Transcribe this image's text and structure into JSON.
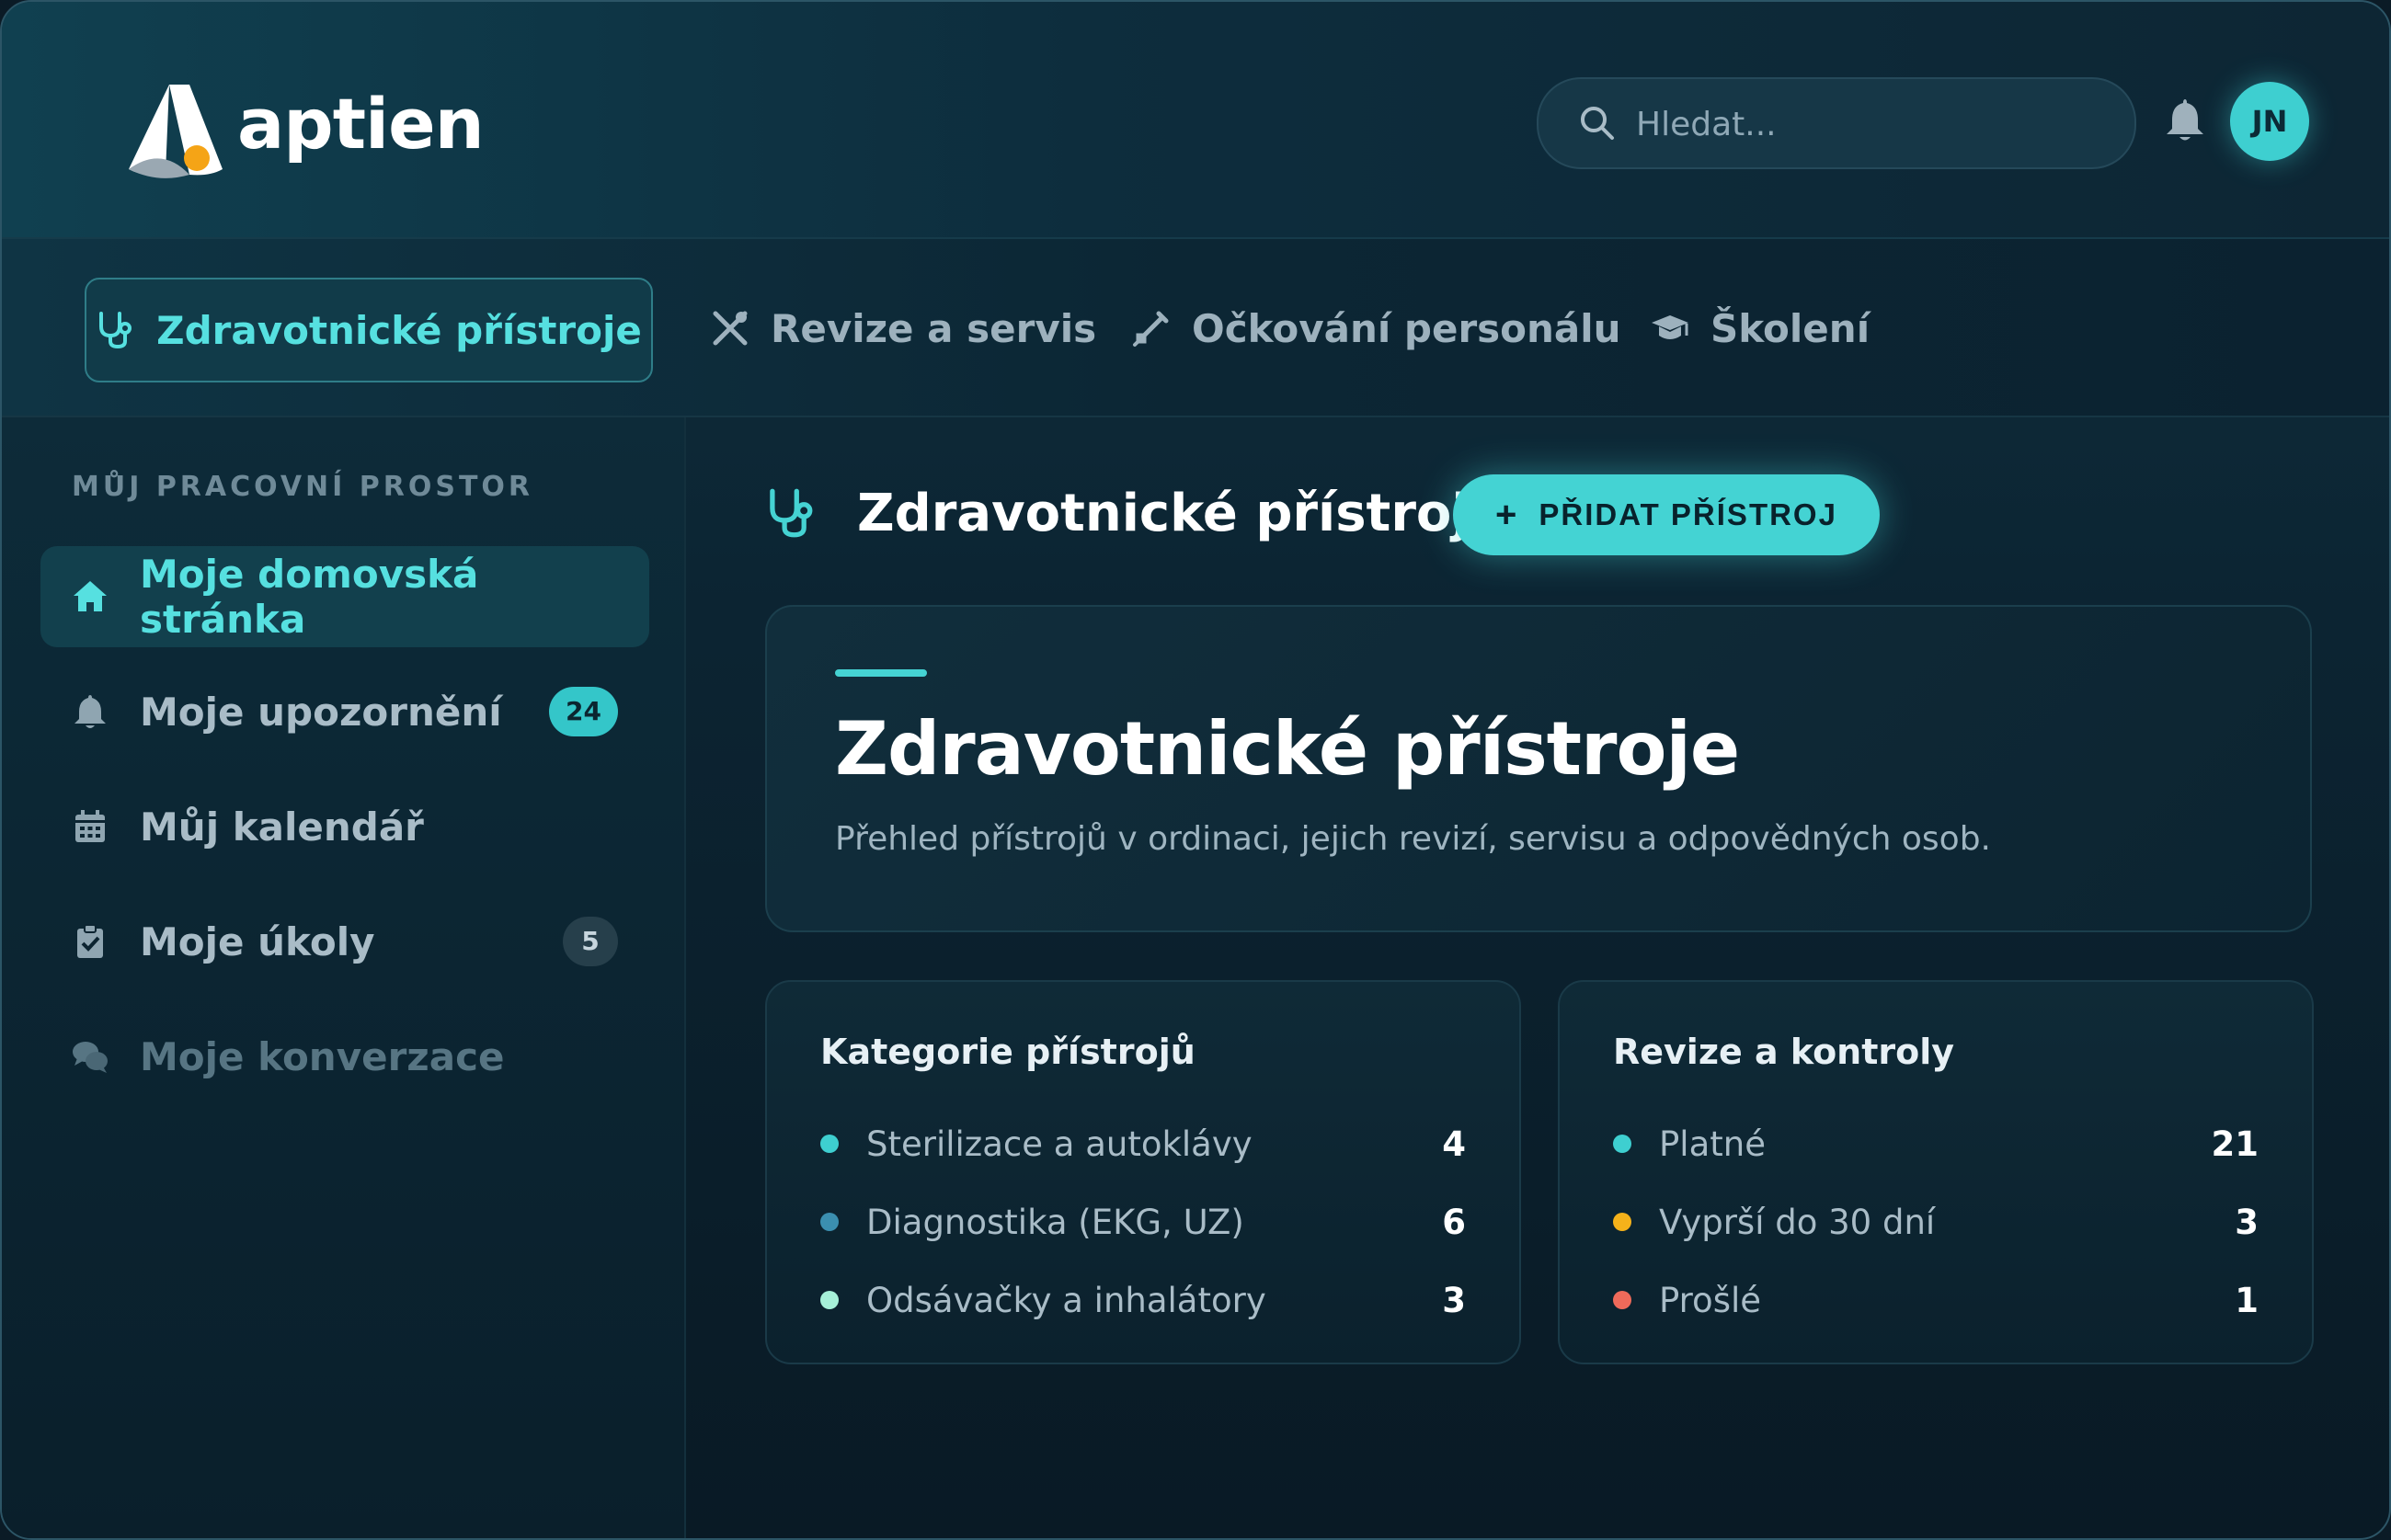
{
  "app": {
    "brand": "aptien"
  },
  "search": {
    "placeholder": "Hledat..."
  },
  "user": {
    "initials": "JN"
  },
  "tabs": [
    {
      "label": "Zdravotnické přístroje",
      "icon": "stethoscope-icon",
      "active": true
    },
    {
      "label": "Revize a servis",
      "icon": "tools-icon"
    },
    {
      "label": "Očkování personálu",
      "icon": "syringe-icon"
    },
    {
      "label": "Školení",
      "icon": "graduation-cap-icon"
    }
  ],
  "sidebar": {
    "heading": "MŮJ PRACOVNÍ PROSTOR",
    "items": [
      {
        "label": "Moje domovská stránka",
        "icon": "home-icon",
        "active": true
      },
      {
        "label": "Moje upozornění",
        "icon": "bell-icon",
        "badge": "24"
      },
      {
        "label": "Můj kalendář",
        "icon": "calendar-icon"
      },
      {
        "label": "Moje úkoly",
        "icon": "clipboard-check-icon",
        "badge": "5"
      },
      {
        "label": "Moje konverzace",
        "icon": "chat-bubbles-icon"
      }
    ]
  },
  "main": {
    "title": "Zdravotnické přístroje",
    "add_button": "PŘIDAT PŘÍSTROJ",
    "add_icon": "+",
    "hero": {
      "title": "Zdravotnické přístroje",
      "description": "Přehled přístrojů v ordinaci, jejich revizí, servisu a odpovědných osob."
    },
    "cards": [
      {
        "title": "Kategorie přístrojů",
        "rows": [
          {
            "label": "Sterilizace a autoklávy",
            "value": "4",
            "color": "#3ecfd0"
          },
          {
            "label": "Diagnostika (EKG, UZ)",
            "value": "6",
            "color": "#3b8fb0"
          },
          {
            "label": "Odsávačky a inhalátory",
            "value": "3",
            "color": "#a6f0d8"
          }
        ]
      },
      {
        "title": "Revize a kontroly",
        "rows": [
          {
            "label": "Platné",
            "value": "21",
            "color": "#3ecfd0"
          },
          {
            "label": "Vyprší do 30 dní",
            "value": "3",
            "color": "#f5b21a"
          },
          {
            "label": "Prošlé",
            "value": "1",
            "color": "#ef6a5a"
          }
        ]
      }
    ]
  },
  "colors": {
    "accent": "#45d3d3",
    "background": "#0b1b26"
  }
}
